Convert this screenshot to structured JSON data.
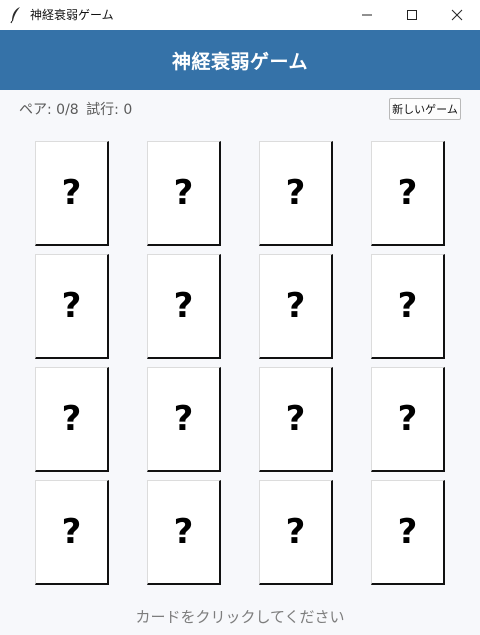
{
  "window": {
    "title": "神経衰弱ゲーム",
    "icon": "feather-icon",
    "controls": [
      "minimize",
      "maximize",
      "close"
    ]
  },
  "header": {
    "title": "神経衰弱ゲーム",
    "background": "#3572a8"
  },
  "status": {
    "pairs": "ペア: 0/8",
    "tries": "試行: 0"
  },
  "toolbar": {
    "new_game_label": "新しいゲーム"
  },
  "board": {
    "columns": 4,
    "rows": 4,
    "cards": [
      "?",
      "?",
      "?",
      "?",
      "?",
      "?",
      "?",
      "?",
      "?",
      "?",
      "?",
      "?",
      "?",
      "?",
      "?",
      "?"
    ]
  },
  "footer": {
    "instruction": "カードをクリックしてください"
  }
}
